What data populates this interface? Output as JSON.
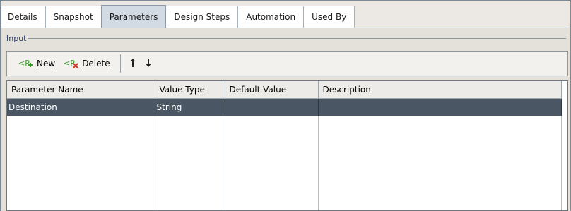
{
  "tabs": [
    {
      "label": "Details",
      "active": false
    },
    {
      "label": "Snapshot",
      "active": false
    },
    {
      "label": "Parameters",
      "active": true
    },
    {
      "label": "Design Steps",
      "active": false
    },
    {
      "label": "Automation",
      "active": false
    },
    {
      "label": "Used By",
      "active": false
    }
  ],
  "section": {
    "legend": "Input"
  },
  "toolbar": {
    "new_label": "New",
    "delete_label": "Delete",
    "new_icon": "new-parameter-icon",
    "delete_icon": "delete-parameter-icon",
    "move_up_icon": "arrow-up-icon",
    "move_down_icon": "arrow-down-icon"
  },
  "table": {
    "columns": [
      "Parameter Name",
      "Value Type",
      "Default Value",
      "Description"
    ],
    "rows": [
      {
        "name": "Destination",
        "value_type": "String",
        "default_value": "",
        "description": "",
        "selected": true
      }
    ]
  },
  "colors": {
    "selected_row": "#4a5664",
    "active_tab": "#d2dbe3",
    "icon_green": "#3c9a2c",
    "icon_red": "#d33a2a"
  }
}
